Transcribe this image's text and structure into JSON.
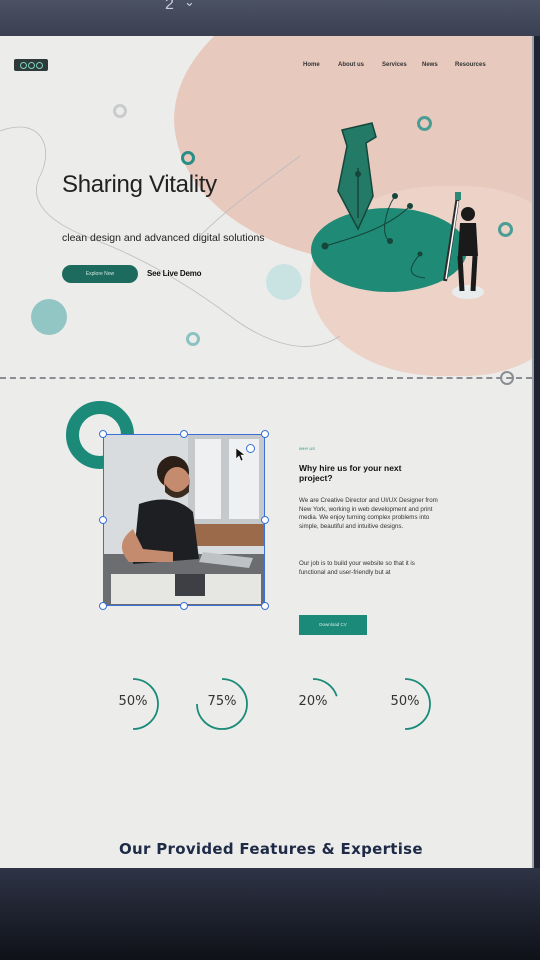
{
  "viewer": {
    "page_number": "2"
  },
  "nav": {
    "items": [
      {
        "label": "Home"
      },
      {
        "label": "About us"
      },
      {
        "label": "Services"
      },
      {
        "label": "News"
      },
      {
        "label": "Resources"
      }
    ]
  },
  "hero": {
    "title": "Sharing Vitality",
    "subtitle": "clean design and advanced digital solutions",
    "primary_button": "Explore Now",
    "secondary_link": "See Live Demo"
  },
  "about": {
    "eyebrow": "WHY US",
    "heading": "Why hire us for your next project?",
    "paragraph1": "We are Creative Director and UI/UX Designer from New York, working in web development and print media. We enjoy turning complex problems into simple, beautiful and intuitive designs.",
    "paragraph2": "Our job is to build your website so that it is functional and user-friendly but at",
    "button": "Download CV"
  },
  "stats": [
    {
      "value": "50%",
      "fraction": 0.5
    },
    {
      "value": "75%",
      "fraction": 0.75
    },
    {
      "value": "20%",
      "fraction": 0.2
    },
    {
      "value": "50%",
      "fraction": 0.5
    }
  ],
  "features": {
    "heading": "Our Provided Features & Expertise"
  },
  "colors": {
    "accent": "#1c8a79",
    "blob": "#e7c9bd",
    "dark_button": "#1d6b5e"
  },
  "icons": [
    "chevron-down-icon",
    "pen-nib-illustration",
    "designer-figure-illustration",
    "cursor-icon",
    "logo"
  ]
}
